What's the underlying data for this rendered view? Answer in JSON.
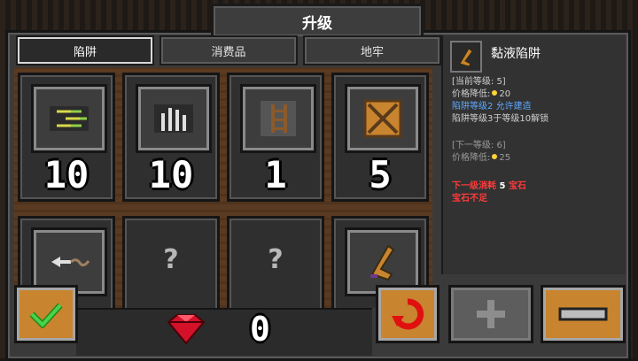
{
  "header": {
    "title": "升级"
  },
  "tabs": [
    {
      "label": "陷阱",
      "active": true
    },
    {
      "label": "消费品",
      "active": false
    },
    {
      "label": "地牢",
      "active": false
    }
  ],
  "cards": [
    {
      "icon": "dart-trap-icon",
      "count": "10"
    },
    {
      "icon": "spike-trap-icon",
      "count": "10"
    },
    {
      "icon": "ladder-trap-icon",
      "count": "1"
    },
    {
      "icon": "crate-trap-icon",
      "count": "5"
    },
    {
      "icon": "arrow-trap-icon",
      "count": ""
    },
    {
      "icon": "locked-icon",
      "count": "",
      "text": "?"
    },
    {
      "icon": "locked-icon",
      "count": "",
      "text": "?"
    },
    {
      "icon": "slime-trap-icon",
      "count": ""
    }
  ],
  "detail": {
    "title": "黏液陷阱",
    "current_level": "[当前等级: 5]",
    "price_drop_label": "价格降低:",
    "price_drop_value": "20",
    "trap_level_prefix": "陷阱等级2",
    "trap_level_suffix": "允许建造",
    "unlock_note": "陷阱等级3于等级10解锁",
    "next_level": "[下一等级: 6]",
    "next_price_label": "价格降低:",
    "next_price_value": "25",
    "cost_prefix": "下一级消耗",
    "cost_value": "5",
    "cost_suffix": "宝石",
    "insufficient": "宝石不足"
  },
  "footer": {
    "gem_count": "0"
  },
  "colors": {
    "accent_orange": "#c8842e",
    "gem_red": "#d3122a",
    "text_blue": "#5fa9ff",
    "warn_red": "#ff3b3b",
    "gold": "#ffd23a"
  }
}
